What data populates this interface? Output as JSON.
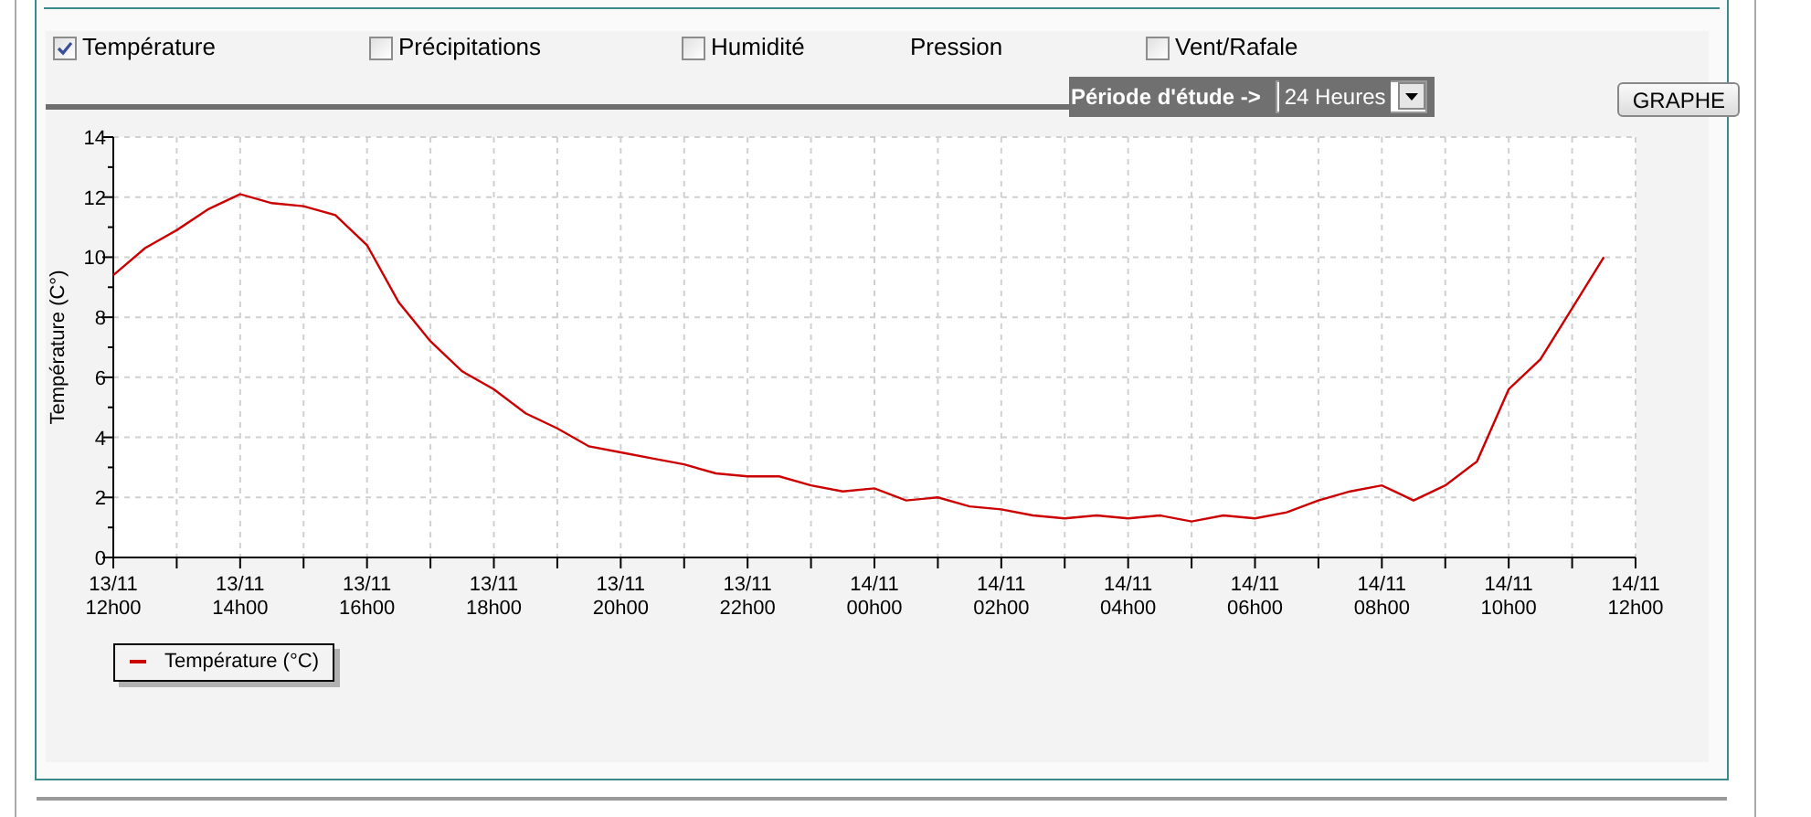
{
  "filters": [
    {
      "kind": "checkbox",
      "label": "Température",
      "checked": true
    },
    {
      "kind": "checkbox",
      "label": "Précipitations",
      "checked": false
    },
    {
      "kind": "checkbox",
      "label": "Humidité",
      "checked": false
    },
    {
      "kind": "text",
      "label": "Pression"
    },
    {
      "kind": "checkbox",
      "label": "Vent/Rafale",
      "checked": false
    }
  ],
  "period": {
    "label": "Période d'étude ->",
    "value": "24 Heures"
  },
  "graph_button": "GRAPHE",
  "chart": {
    "chart_data": {
      "type": "line",
      "grid": true,
      "ylabel": "Température (C°)",
      "ylim": [
        0,
        14
      ],
      "yticks": [
        0,
        2,
        4,
        6,
        8,
        10,
        12,
        14
      ],
      "categories": [
        "13/11 12h00",
        null,
        null,
        null,
        "13/11 14h00",
        null,
        null,
        null,
        "13/11 16h00",
        null,
        null,
        null,
        "13/11 18h00",
        null,
        null,
        null,
        "13/11 20h00",
        null,
        null,
        null,
        "13/11 22h00",
        null,
        null,
        null,
        "14/11 00h00",
        null,
        null,
        null,
        "14/11 02h00",
        null,
        null,
        null,
        "14/11 04h00",
        null,
        null,
        null,
        "14/11 06h00",
        null,
        null,
        null,
        "14/11 08h00",
        null,
        null,
        null,
        "14/11 10h00",
        null,
        null,
        null,
        "14/11 12h00"
      ],
      "series": [
        {
          "name": "Température (°C)",
          "color": "#cc0000",
          "values": [
            9.4,
            10.3,
            10.9,
            11.6,
            12.1,
            11.8,
            11.7,
            11.4,
            10.4,
            8.5,
            7.2,
            6.2,
            5.6,
            4.8,
            4.3,
            3.7,
            3.5,
            3.3,
            3.1,
            2.8,
            2.7,
            2.7,
            2.4,
            2.2,
            2.3,
            1.9,
            2.0,
            1.7,
            1.6,
            1.4,
            1.3,
            1.4,
            1.3,
            1.4,
            1.2,
            1.4,
            1.3,
            1.5,
            1.9,
            2.2,
            2.4,
            1.9,
            2.4,
            3.2,
            5.6,
            6.6,
            8.3,
            10.0,
            null
          ]
        }
      ]
    }
  }
}
